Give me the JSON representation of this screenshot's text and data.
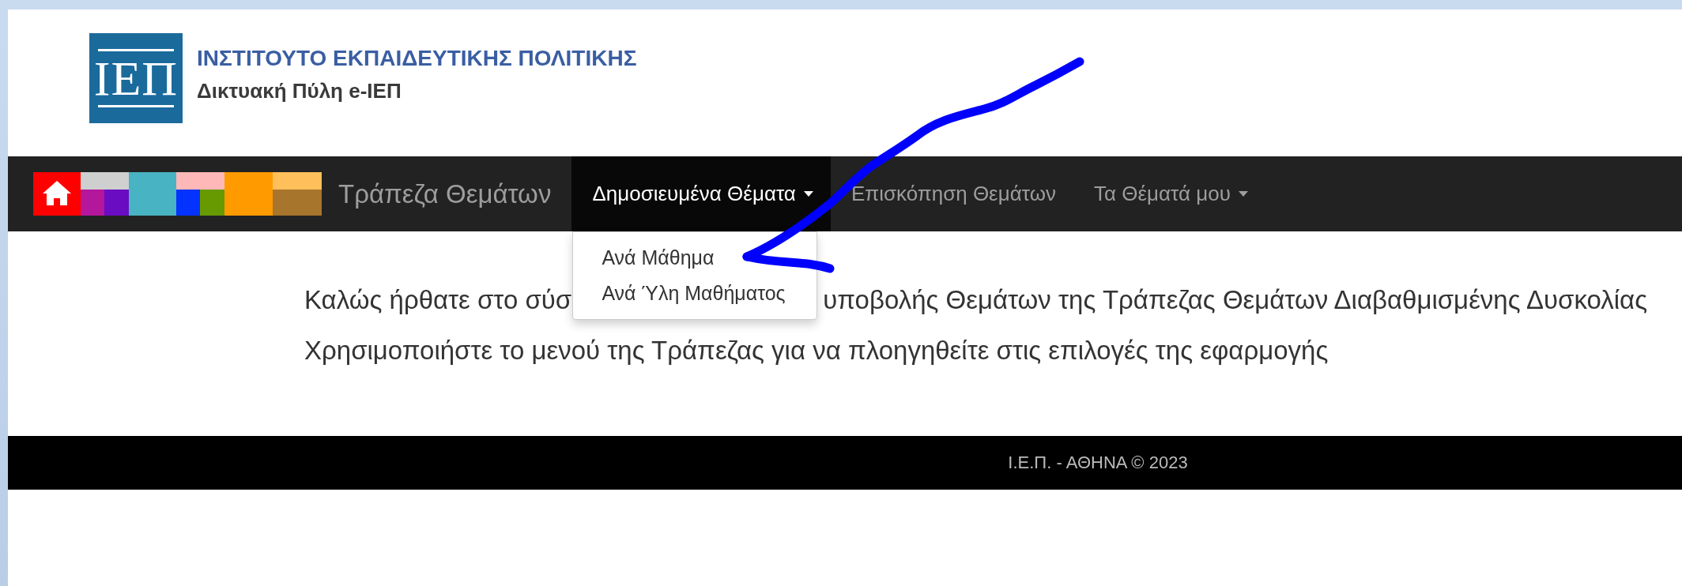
{
  "header": {
    "logo_text": "ΙΕΠ",
    "title": "ΙΝΣΤΙΤΟΥΤΟ ΕΚΠΑΙΔΕΥΤΙΚΗΣ ΠΟΛΙΤΙΚΗΣ",
    "subtitle": "Δικτυακή Πύλη e-ΙΕΠ"
  },
  "navbar": {
    "brand": "Τράπεζα Θεμάτων",
    "items": [
      {
        "label": "Δημοσιευμένα Θέματα",
        "selected": true,
        "caret": true,
        "expanded": true,
        "menu": [
          "Ανά Μάθημα",
          "Ανά Ύλη Μαθήματος"
        ]
      },
      {
        "label": "Επισκόπηση Θεμάτων",
        "selected": false,
        "caret": false,
        "expanded": false
      },
      {
        "label": "Τα Θέματά μου",
        "selected": false,
        "caret": true,
        "expanded": false
      }
    ]
  },
  "welcome": {
    "line_1_parts": [
      "Καλώς ήρθατε στο σύσ",
      "υποβολής Θεμάτων της Τράπεζας Θεμάτων Διαβαθμισμένης Δυσκολίας"
    ],
    "line_2": "Χρησιμοποιήστε το μενού της Τράπεζας για να πλοηγηθείτε στις επιλογές της εφαρμογής"
  },
  "footer": {
    "text": "Ι.Ε.Π. - ΑΘΗΝΑ © 2023"
  },
  "annotation": {
    "kind": "arrow"
  }
}
